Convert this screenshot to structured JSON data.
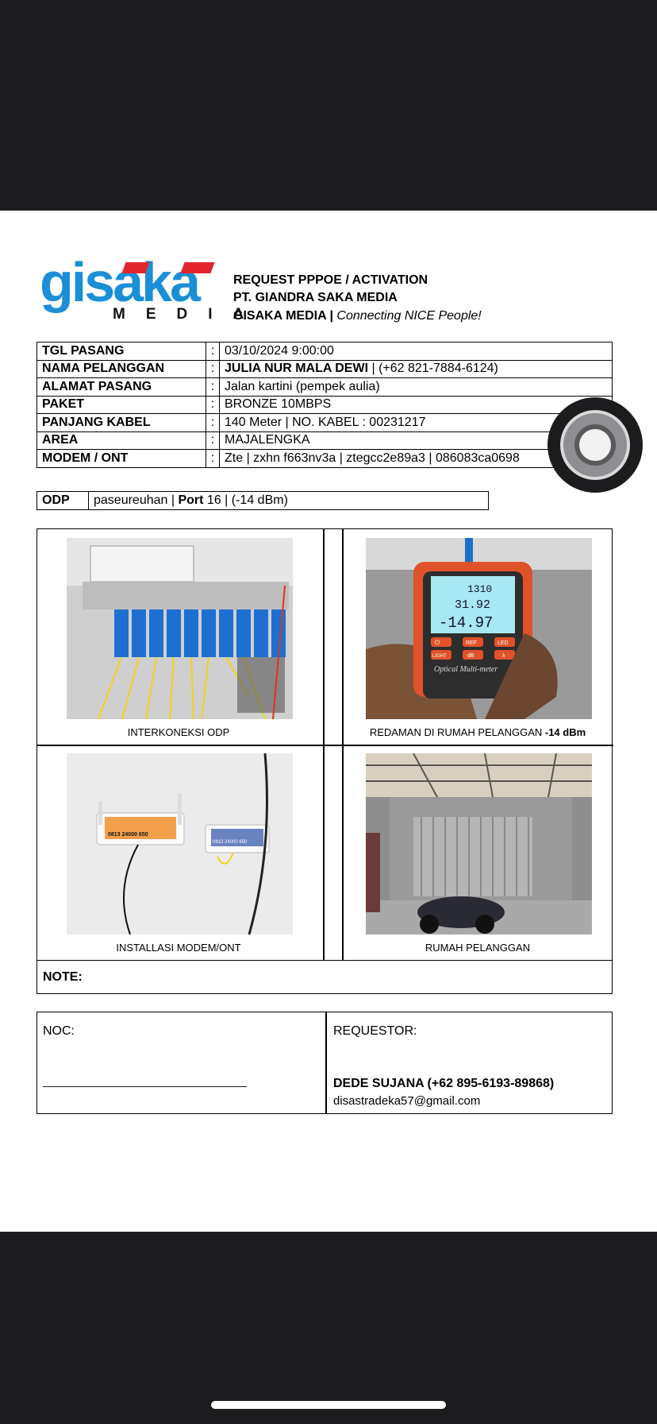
{
  "logo": {
    "word": "gisaka",
    "sub": "MEDIA"
  },
  "header": {
    "line1": "REQUEST PPPOE / ACTIVATION",
    "line2": "PT. GIANDRA SAKA MEDIA",
    "line3_bold": "GISAKA MEDIA |",
    "line3_italic": "Connecting NICE People!"
  },
  "info": [
    {
      "key": "TGL PASANG",
      "colon": ":",
      "value": "03/10/2024 9:00:00"
    },
    {
      "key": "NAMA PELANGGAN",
      "colon": ":",
      "value_bold": "JULIA NUR MALA DEWI",
      "value": " | (+62 821-7884-6124)"
    },
    {
      "key": "ALAMAT PASANG",
      "colon": ":",
      "value": "Jalan kartini (pempek aulia)"
    },
    {
      "key": "PAKET",
      "colon": ":",
      "value": "BRONZE 10MBPS"
    },
    {
      "key": "PANJANG KABEL",
      "colon": ":",
      "value": "140  Meter  | NO. KABEL : 00231217"
    },
    {
      "key": "AREA",
      "colon": ":",
      "value": "MAJALENGKA"
    },
    {
      "key": "MODEM / ONT",
      "colon": ":",
      "value": "Zte |  zxhn f663nv3a | ztegcc2e89a3 |  086083ca0698"
    }
  ],
  "odp": {
    "label": "ODP",
    "location": "paseureuhan |",
    "port_label": "Port",
    "port_value": "16 |  (-14 dBm)"
  },
  "photos": {
    "p1_caption": "INTERKONEKSI ODP",
    "p2_caption": "REDAMAN DI RUMAH PELANGGAN",
    "p2_caption_bold": "-14 dBm",
    "p3_caption": "INSTALLASI MODEM/ONT",
    "p4_caption": "RUMAH PELANGGAN",
    "meter_line1": "1310",
    "meter_line2": "31.92",
    "meter_line3": "-14.97",
    "meter_brand": "Optical Multi-meter",
    "meter_btn1": "⏻",
    "meter_btn2": "REF",
    "meter_btn3": "LED",
    "meter_btn4": "LIGHT",
    "meter_btn5": "dB",
    "meter_btn6": "λ",
    "modem_label": "0813 24000 650"
  },
  "note": {
    "label": "NOTE:"
  },
  "signature": {
    "noc_label": "NOC:",
    "noc_line": "_________________________________",
    "requestor_label": "REQUESTOR:",
    "requestor_name": "DEDE SUJANA (+62 895-6193-89868)",
    "requestor_email": "disastradeka57@gmail.com"
  },
  "colors": {
    "brand_blue": "#1b8fd6",
    "brand_red": "#e3262b",
    "frame": "#1c1c1e"
  }
}
